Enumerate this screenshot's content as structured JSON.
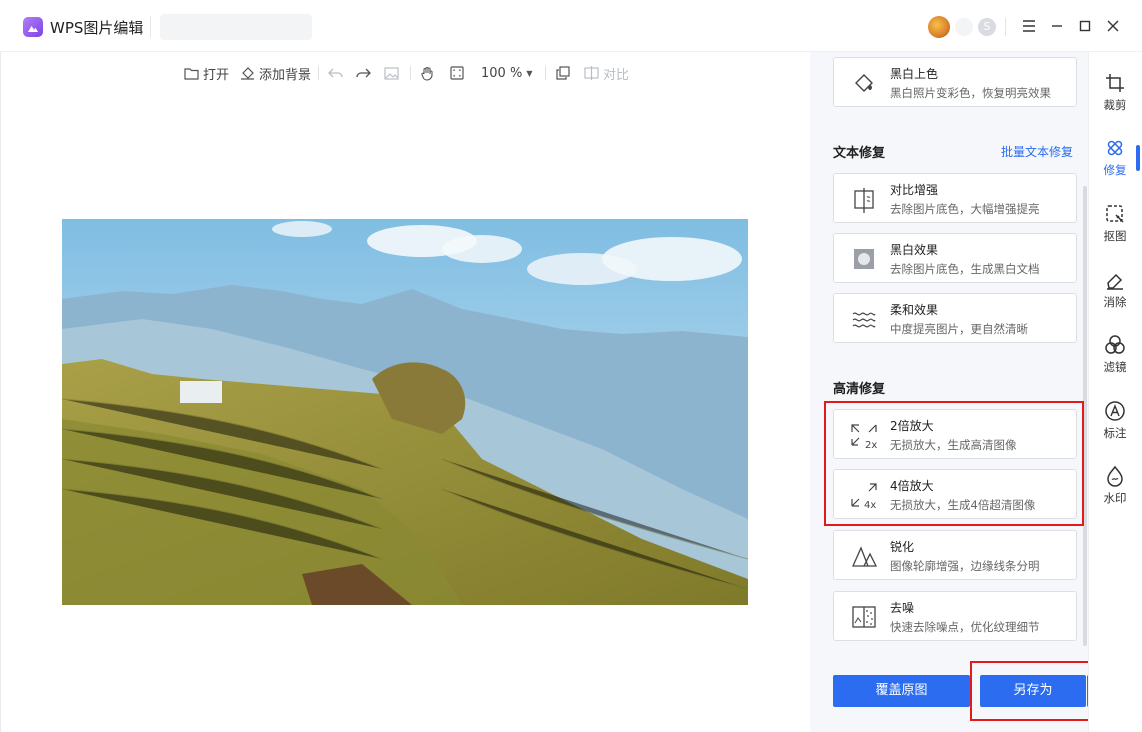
{
  "app": {
    "title": "WPS图片编辑"
  },
  "toolbar": {
    "open": "打开",
    "add_bg": "添加背景",
    "zoom": "100 %",
    "compare": "对比"
  },
  "panel": {
    "top_card": {
      "title": "黑白上色",
      "desc": "黑白照片变彩色，恢复明亮效果"
    },
    "text_section": {
      "title": "文本修复",
      "link": "批量文本修复",
      "cards": [
        {
          "title": "对比增强",
          "desc": "去除图片底色，大幅增强提亮",
          "icon": "contrast-doc-icon"
        },
        {
          "title": "黑白效果",
          "desc": "去除图片底色，生成黑白文档",
          "icon": "bw-doc-icon"
        },
        {
          "title": "柔和效果",
          "desc": "中度提亮图片，更自然清晰",
          "icon": "wave-icon"
        }
      ]
    },
    "hd_section": {
      "title": "高清修复",
      "cards": [
        {
          "title": "2倍放大",
          "desc": "无损放大，生成高清图像",
          "badge": "2x"
        },
        {
          "title": "4倍放大",
          "desc": "无损放大，生成4倍超清图像",
          "badge": "4x"
        },
        {
          "title": "锐化",
          "desc": "图像轮廓增强，边缘线条分明"
        },
        {
          "title": "去噪",
          "desc": "快速去除噪点，优化纹理细节"
        }
      ]
    },
    "buttons": {
      "overwrite": "覆盖原图",
      "save_as": "另存为"
    }
  },
  "rail": [
    {
      "label": "裁剪",
      "icon": "crop-icon"
    },
    {
      "label": "修复",
      "icon": "repair-icon",
      "active": true
    },
    {
      "label": "抠图",
      "icon": "cutout-icon"
    },
    {
      "label": "消除",
      "icon": "eraser-icon"
    },
    {
      "label": "滤镜",
      "icon": "filter-icon"
    },
    {
      "label": "标注",
      "icon": "annotate-icon"
    },
    {
      "label": "水印",
      "icon": "watermark-icon"
    }
  ],
  "colors": {
    "accent": "#2b6cf0",
    "highlight": "#e11b1b"
  }
}
